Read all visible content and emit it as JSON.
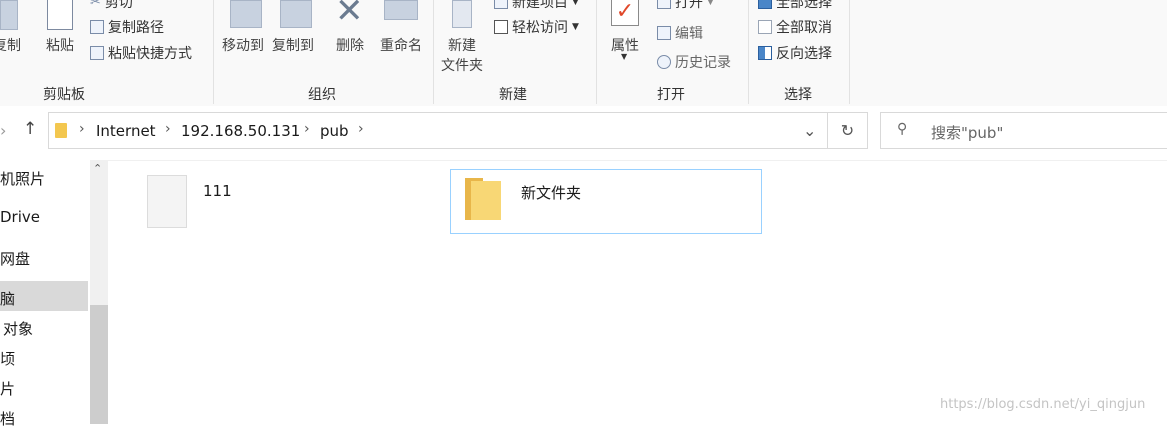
{
  "ribbon": {
    "clipboard": {
      "copy_label": "复制",
      "paste_label": "粘贴",
      "cut_label": "剪切",
      "copy_path_label": "复制路径",
      "paste_shortcut_label": "粘贴快捷方式",
      "group_label": "剪贴板"
    },
    "organize": {
      "move_to_label": "移动到",
      "copy_to_label": "复制到",
      "delete_label": "删除",
      "rename_label": "重命名",
      "group_label": "组织"
    },
    "new": {
      "new_folder_label_1": "新建",
      "new_folder_label_2": "文件夹",
      "new_item_label": "新建项目",
      "easy_access_label": "轻松访问",
      "group_label": "新建"
    },
    "open": {
      "properties_label": "属性",
      "open_label": "打开",
      "edit_label": "编辑",
      "history_label": "历史记录",
      "group_label": "打开"
    },
    "select": {
      "select_all_label": "全部选择",
      "select_none_label": "全部取消",
      "invert_label": "反向选择",
      "group_label": "选择"
    }
  },
  "address": {
    "crumbs": [
      "Internet",
      "192.168.50.131",
      "pub"
    ],
    "search_placeholder": "搜索\"pub\""
  },
  "nav": {
    "items": [
      "机照片",
      "Drive",
      "网盘",
      "脑",
      "对象",
      "顷",
      "片",
      "档"
    ]
  },
  "files": [
    {
      "name": "111",
      "type": "file"
    },
    {
      "name": "新文件夹",
      "type": "folder"
    }
  ],
  "watermark": "https://blog.csdn.net/yi_qingjun"
}
